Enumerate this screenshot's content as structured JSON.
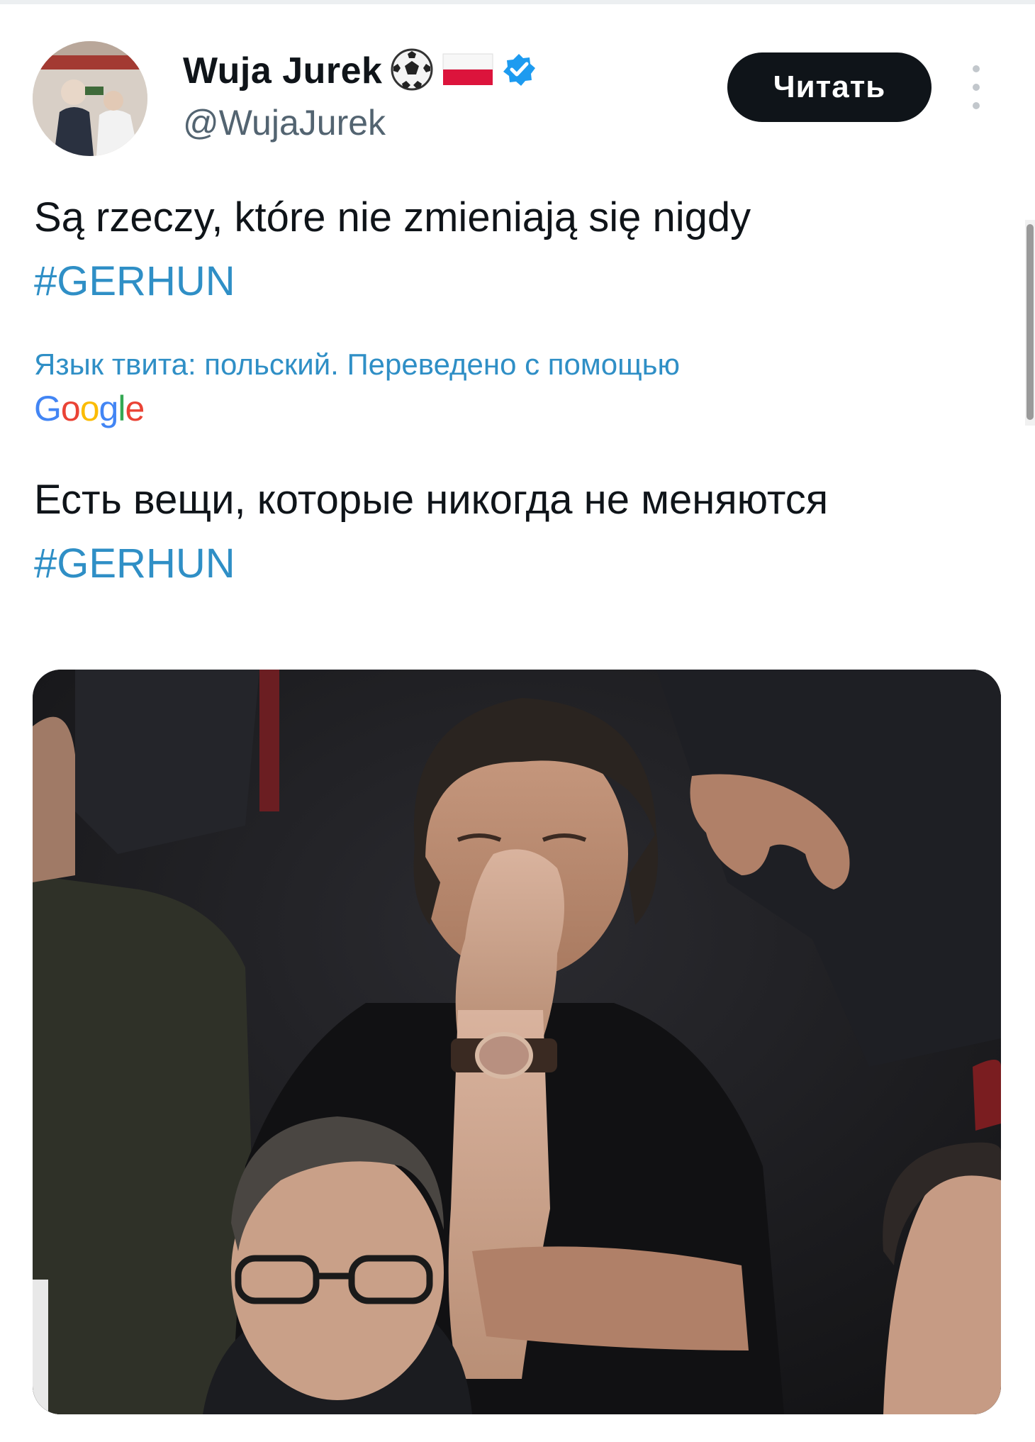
{
  "tweet": {
    "author": {
      "display_name": "Wuja Jurek",
      "handle": "@WujaJurek",
      "emoji": [
        "soccer-ball",
        "flag-poland"
      ],
      "verified": true
    },
    "follow_button_label": "Читать",
    "original_text": {
      "text": "Są rzeczy, które nie zmieniają się nigdy",
      "hashtag": "#GERHUN"
    },
    "translation_note": "Язык твита: польский. Переведено с помощью",
    "translation_provider": {
      "letters": [
        "G",
        "o",
        "o",
        "g",
        "l",
        "e"
      ]
    },
    "translated_text": {
      "text": "Есть вещи, которые никогда не меняются",
      "hashtag": "#GERHUN"
    }
  },
  "colors": {
    "text": "#0f1419",
    "secondary_text": "#536471",
    "link": "#2f8fc6",
    "verified_badge": "#1d9bf0",
    "button_bg": "#0f1419"
  }
}
